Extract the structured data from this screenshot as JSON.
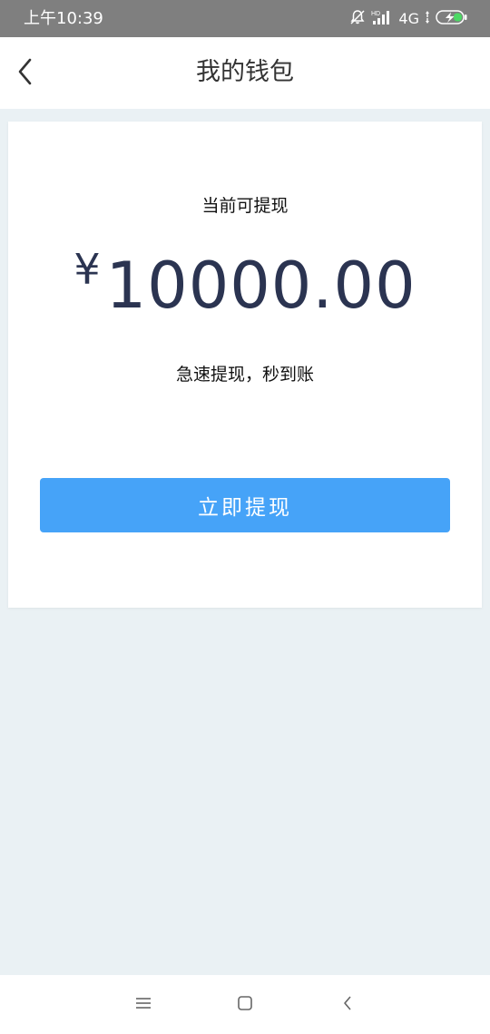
{
  "status_bar": {
    "time": "上午10:39",
    "network": "4G",
    "icons": [
      "mute-icon",
      "signal-icon",
      "battery-charging-icon"
    ]
  },
  "header": {
    "title": "我的钱包",
    "back_icon": "chevron-left-icon"
  },
  "wallet": {
    "balance_label": "当前可提现",
    "currency_symbol": "¥",
    "amount": "10000.00",
    "tip": "急速提现，秒到账",
    "withdraw_button_label": "立即提现"
  },
  "nav_bar": {
    "icons": [
      "menu-icon",
      "home-icon",
      "back-icon"
    ]
  },
  "colors": {
    "status_bar_bg": "#7f7f7f",
    "page_bg": "#eaf1f4",
    "button_blue": "#46a3f8",
    "amount_text": "#2b3451",
    "battery_green": "#4cd964"
  }
}
